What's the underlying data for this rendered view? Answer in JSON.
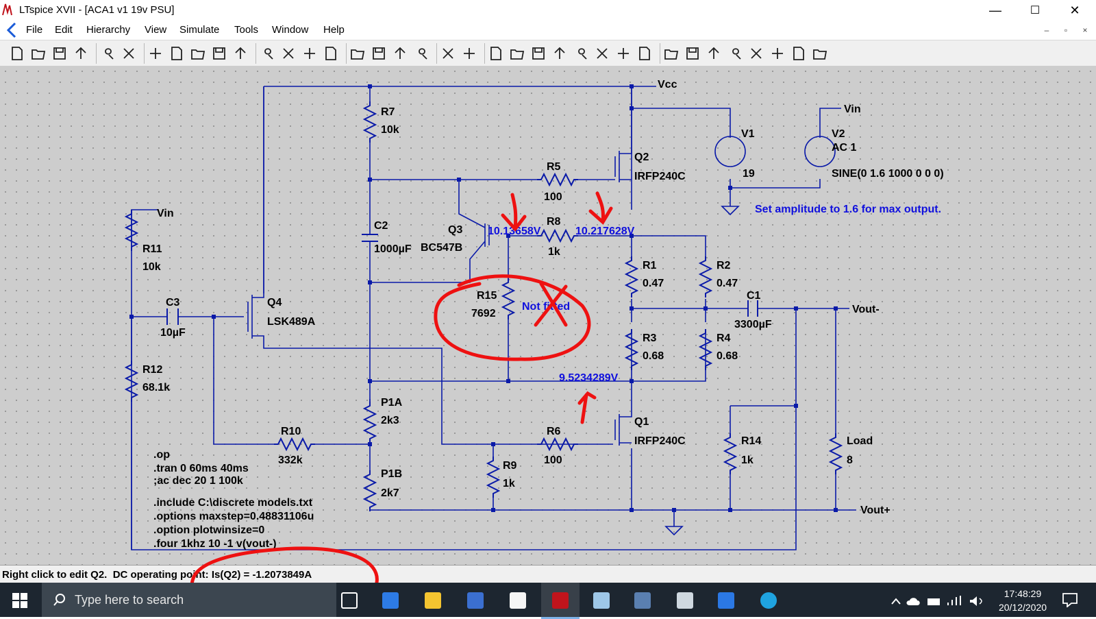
{
  "window": {
    "title": "LTspice XVII - [ACA1 v1 19v PSU]",
    "controls": {
      "minimize": "—",
      "maximize": "☐",
      "close": "✕"
    }
  },
  "menu": {
    "items": [
      "File",
      "Edit",
      "Hierarchy",
      "View",
      "Simulate",
      "Tools",
      "Window",
      "Help"
    ],
    "mdi_controls": [
      "–",
      "▫",
      "×"
    ]
  },
  "toolbar": {
    "icons": [
      "new-schematic-icon",
      "open-icon",
      "save-icon",
      "control-panel-icon",
      "run-icon",
      "halt-icon",
      "zoom-in-icon",
      "pan-icon",
      "zoom-out-icon",
      "zoom-fit-icon",
      "autorange-icon",
      "waveform-icon",
      "tile-horizontal-icon",
      "tile-vertical-icon",
      "cascade-icon",
      "cut-icon",
      "copy-icon",
      "paste-icon",
      "find-icon",
      "print-setup-icon",
      "print-icon",
      "draw-wire-icon",
      "ground-icon",
      "label-net-icon",
      "resistor-icon",
      "capacitor-icon",
      "inductor-icon",
      "diode-icon",
      "component-icon",
      "move-icon",
      "drag-icon",
      "undo-icon",
      "redo-icon",
      "rotate-icon",
      "mirror-icon",
      "text-icon",
      "spice-directive-icon"
    ]
  },
  "schematic": {
    "nets": {
      "vcc": "Vcc",
      "vin_top": "Vin",
      "vin_left": "Vin",
      "vout_minus": "Vout-",
      "vout_plus": "Vout+"
    },
    "components": {
      "R7": {
        "name": "R7",
        "value": "10k"
      },
      "R5": {
        "name": "R5",
        "value": "100"
      },
      "R8": {
        "name": "R8",
        "value": "1k"
      },
      "R15": {
        "name": "R15",
        "value": "7692",
        "note": "Not fitted"
      },
      "R11": {
        "name": "R11",
        "value": "10k"
      },
      "R12": {
        "name": "R12",
        "value": "68.1k"
      },
      "R10": {
        "name": "R10",
        "value": "332k"
      },
      "R1": {
        "name": "R1",
        "value": "0.47"
      },
      "R2": {
        "name": "R2",
        "value": "0.47"
      },
      "R3": {
        "name": "R3",
        "value": "0.68"
      },
      "R4": {
        "name": "R4",
        "value": "0.68"
      },
      "R6": {
        "name": "R6",
        "value": "100"
      },
      "R9": {
        "name": "R9",
        "value": "1k"
      },
      "R14": {
        "name": "R14",
        "value": "1k"
      },
      "P1A": {
        "name": "P1A",
        "value": "2k3"
      },
      "P1B": {
        "name": "P1B",
        "value": "2k7"
      },
      "Load": {
        "name": "Load",
        "value": "8"
      },
      "C1": {
        "name": "C1",
        "value": "3300µF"
      },
      "C2": {
        "name": "C2",
        "value": "1000µF"
      },
      "C3": {
        "name": "C3",
        "value": "10µF"
      },
      "Q1": {
        "name": "Q1",
        "value": "IRFP240C"
      },
      "Q2": {
        "name": "Q2",
        "value": "IRFP240C"
      },
      "Q3": {
        "name": "Q3",
        "value": "BC547B"
      },
      "Q4": {
        "name": "Q4",
        "value": "LSK489A"
      },
      "V1": {
        "name": "V1",
        "value": "19"
      },
      "V2": {
        "name": "V2",
        "value": "AC 1",
        "source": "SINE(0 1.6 1000 0 0 0)"
      }
    },
    "voltage_probes": [
      "10.13658V",
      "10.217628V",
      "9.5234289V"
    ],
    "comment": "Set amplitude to 1.6 for max output.",
    "directives": [
      ".op",
      ".tran 0 60ms 40ms",
      ";ac dec 20 1 100k",
      ".include C:\\discrete models.txt",
      ".options maxstep=0.48831106u",
      ".option plotwinsize=0",
      ".four 1khz 10 -1 v(vout-)"
    ],
    "colors": {
      "wire": "#0a1aa8",
      "probe": "#1010dd",
      "annotation": "#ee1111",
      "background": "#cdcdcd"
    }
  },
  "status": {
    "text": "Right click to edit Q2.  DC operating point: Is(Q2) = -1.2073849A"
  },
  "taskbar": {
    "search_placeholder": "Type here to search",
    "apps": [
      "task-view-icon",
      "edge-refresh-icon",
      "file-explorer-icon",
      "bank-icon",
      "notepad-icon",
      "ltspice-icon",
      "tablet-icon",
      "calculator-icon",
      "snip-icon",
      "mail-icon",
      "edge-icon"
    ],
    "time": "17:48:29",
    "date": "20/12/2020"
  }
}
